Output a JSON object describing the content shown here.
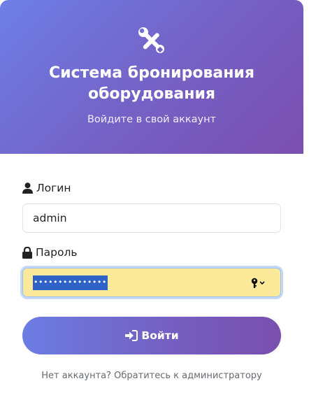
{
  "header": {
    "icon": "tools-icon",
    "title_line1": "Система бронирования",
    "title_line2": "оборудования",
    "subtitle": "Войдите в свой аккаунт"
  },
  "form": {
    "login": {
      "label": "Логин",
      "icon": "user-icon",
      "value": "admin"
    },
    "password": {
      "label": "Пароль",
      "icon": "lock-icon",
      "value": "•••••••••••••••",
      "autofill_icon": "key-icon"
    },
    "submit": {
      "label": "Войти",
      "icon": "sign-in-icon"
    }
  },
  "footer": {
    "text": "Нет аккаунта? Обратитесь к администратору"
  },
  "colors": {
    "gradient_start": "#6d7fe6",
    "gradient_end": "#7b4fb0",
    "autofill_bg": "#fde99a",
    "selection": "#2f62c6"
  }
}
